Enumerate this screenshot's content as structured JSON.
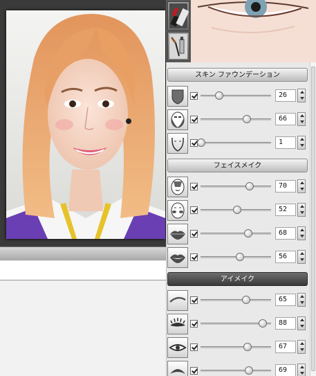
{
  "panel": {
    "sections": [
      {
        "title": "スキン ファウンデーション",
        "style": "light",
        "rows": [
          {
            "icon": "foundation-shield-icon",
            "value": "26",
            "level": 26
          },
          {
            "icon": "face-contour-icon",
            "value": "66",
            "level": 66
          },
          {
            "icon": "face-outline-icon",
            "value": "1",
            "level": 1
          }
        ]
      },
      {
        "title": "フェイスメイク",
        "style": "light",
        "rows": [
          {
            "icon": "face-shade-icon",
            "value": "70",
            "level": 70
          },
          {
            "icon": "blush-face-icon",
            "value": "52",
            "level": 52
          },
          {
            "icon": "lips-icon",
            "value": "68",
            "level": 68
          },
          {
            "icon": "lips-open-icon",
            "value": "56",
            "level": 56
          }
        ]
      },
      {
        "title": "アイメイク",
        "style": "dark",
        "rows": [
          {
            "icon": "eyebrow-icon",
            "value": "65",
            "level": 65
          },
          {
            "icon": "eyelash-icon",
            "value": "88",
            "level": 88
          },
          {
            "icon": "eyeliner-icon",
            "value": "67",
            "level": 67
          },
          {
            "icon": "eyeshadow-icon",
            "value": "69",
            "level": 69
          }
        ]
      }
    ]
  },
  "tools": [
    "lipstick-icon",
    "makeup-brush-icon"
  ],
  "colors": {
    "accent_dark": "#3a3a3a",
    "panel_bg": "#e9e9e9",
    "hair": "#e8a26a"
  }
}
